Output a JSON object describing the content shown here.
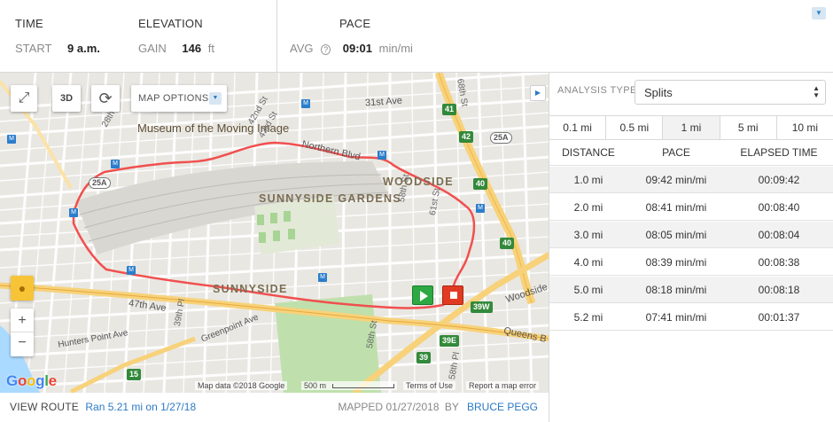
{
  "stats": {
    "time": {
      "header": "TIME",
      "start_key": "START",
      "start_value": "9 a.m."
    },
    "elevation": {
      "header": "ELEVATION",
      "gain_key": "GAIN",
      "gain_value": "146",
      "gain_unit": "ft"
    },
    "pace": {
      "header": "PACE",
      "avg_key": "AVG",
      "avg_value": "09:01",
      "avg_unit": "min/mi"
    }
  },
  "map": {
    "options_label": "MAP OPTIONS",
    "btn_3d": "3D",
    "places": {
      "museum": "Museum of the Moving Image",
      "sunnyside_gardens": "SUNNYSIDE GARDENS",
      "woodside": "WOODSIDE",
      "sunnyside": "SUNNYSIDE"
    },
    "streets": {
      "ave_31st": "31st Ave",
      "northern_blvd": "Northern Blvd",
      "ave_47th": "47th Ave",
      "greenpoint": "Greenpoint Ave",
      "hunters_point": "Hunters Point Ave",
      "queens_blvd": "Queens B",
      "woodside_ave": "Woodside",
      "st_68th": "68th St",
      "st_58th_a": "58th St",
      "st_61st": "61st St",
      "st_39th": "39th Pl",
      "st_58th_b": "58th St",
      "st_58th_c": "58th Pl",
      "st_42nd": "42nd St",
      "st_43rd": "43rd St",
      "st_28th": "28th"
    },
    "shields": [
      "41",
      "42",
      "25A",
      "25A",
      "40",
      "40",
      "39W",
      "39E",
      "39",
      "15"
    ],
    "footer": {
      "data": "Map data ©2018 Google",
      "scale": "500 m",
      "terms": "Terms of Use",
      "report": "Report a map error"
    },
    "google": [
      "G",
      "o",
      "o",
      "g",
      "l",
      "e"
    ],
    "route_color": "#f0504f",
    "start_color": "#2ea843",
    "end_color": "#e23a22"
  },
  "bottom": {
    "view_route": "VIEW ROUTE",
    "route_desc": "Ran 5.21 mi on 1/27/18",
    "mapped_label": "MAPPED",
    "mapped_date": "01/27/2018",
    "by": "BY",
    "author": "BRUCE PEGG"
  },
  "analysis": {
    "label": "ANALYSIS TYPE:",
    "selected": "Splits",
    "tabs": [
      "0.1 mi",
      "0.5 mi",
      "1 mi",
      "5 mi",
      "10 mi"
    ],
    "active_tab": 2,
    "columns": [
      "DISTANCE",
      "PACE",
      "ELAPSED TIME"
    ],
    "rows": [
      [
        "1.0 mi",
        "09:42 min/mi",
        "00:09:42"
      ],
      [
        "2.0 mi",
        "08:41 min/mi",
        "00:08:40"
      ],
      [
        "3.0 mi",
        "08:05 min/mi",
        "00:08:04"
      ],
      [
        "4.0 mi",
        "08:39 min/mi",
        "00:08:38"
      ],
      [
        "5.0 mi",
        "08:18 min/mi",
        "00:08:18"
      ],
      [
        "5.2 mi",
        "07:41 min/mi",
        "00:01:37"
      ]
    ]
  }
}
